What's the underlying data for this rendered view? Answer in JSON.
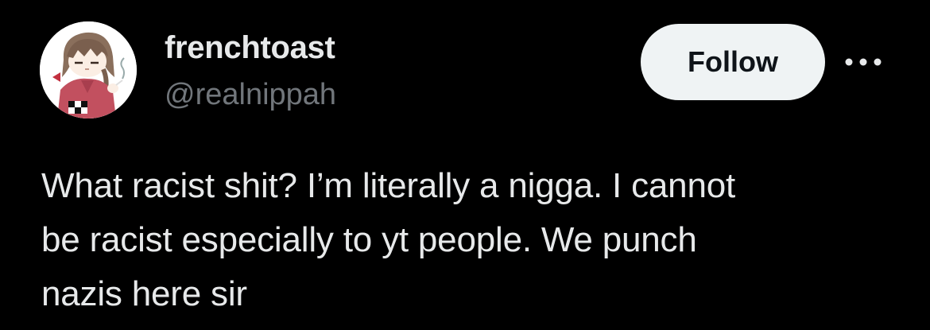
{
  "user": {
    "display_name": "frenchtoast",
    "handle": "@realnippah",
    "avatar_icon": "anime-character-avatar-icon"
  },
  "actions": {
    "follow_label": "Follow",
    "more_icon": "more-options-icon"
  },
  "tweet": {
    "text": "What racist shit? I’m literally a nigga. I cannot\nbe racist especially to yt people. We punch\nnazis here sir"
  },
  "colors": {
    "background": "#000000",
    "primary_text": "#e7e9ea",
    "secondary_text": "#71767b",
    "follow_bg": "#eff3f4",
    "follow_text": "#0f1419"
  }
}
